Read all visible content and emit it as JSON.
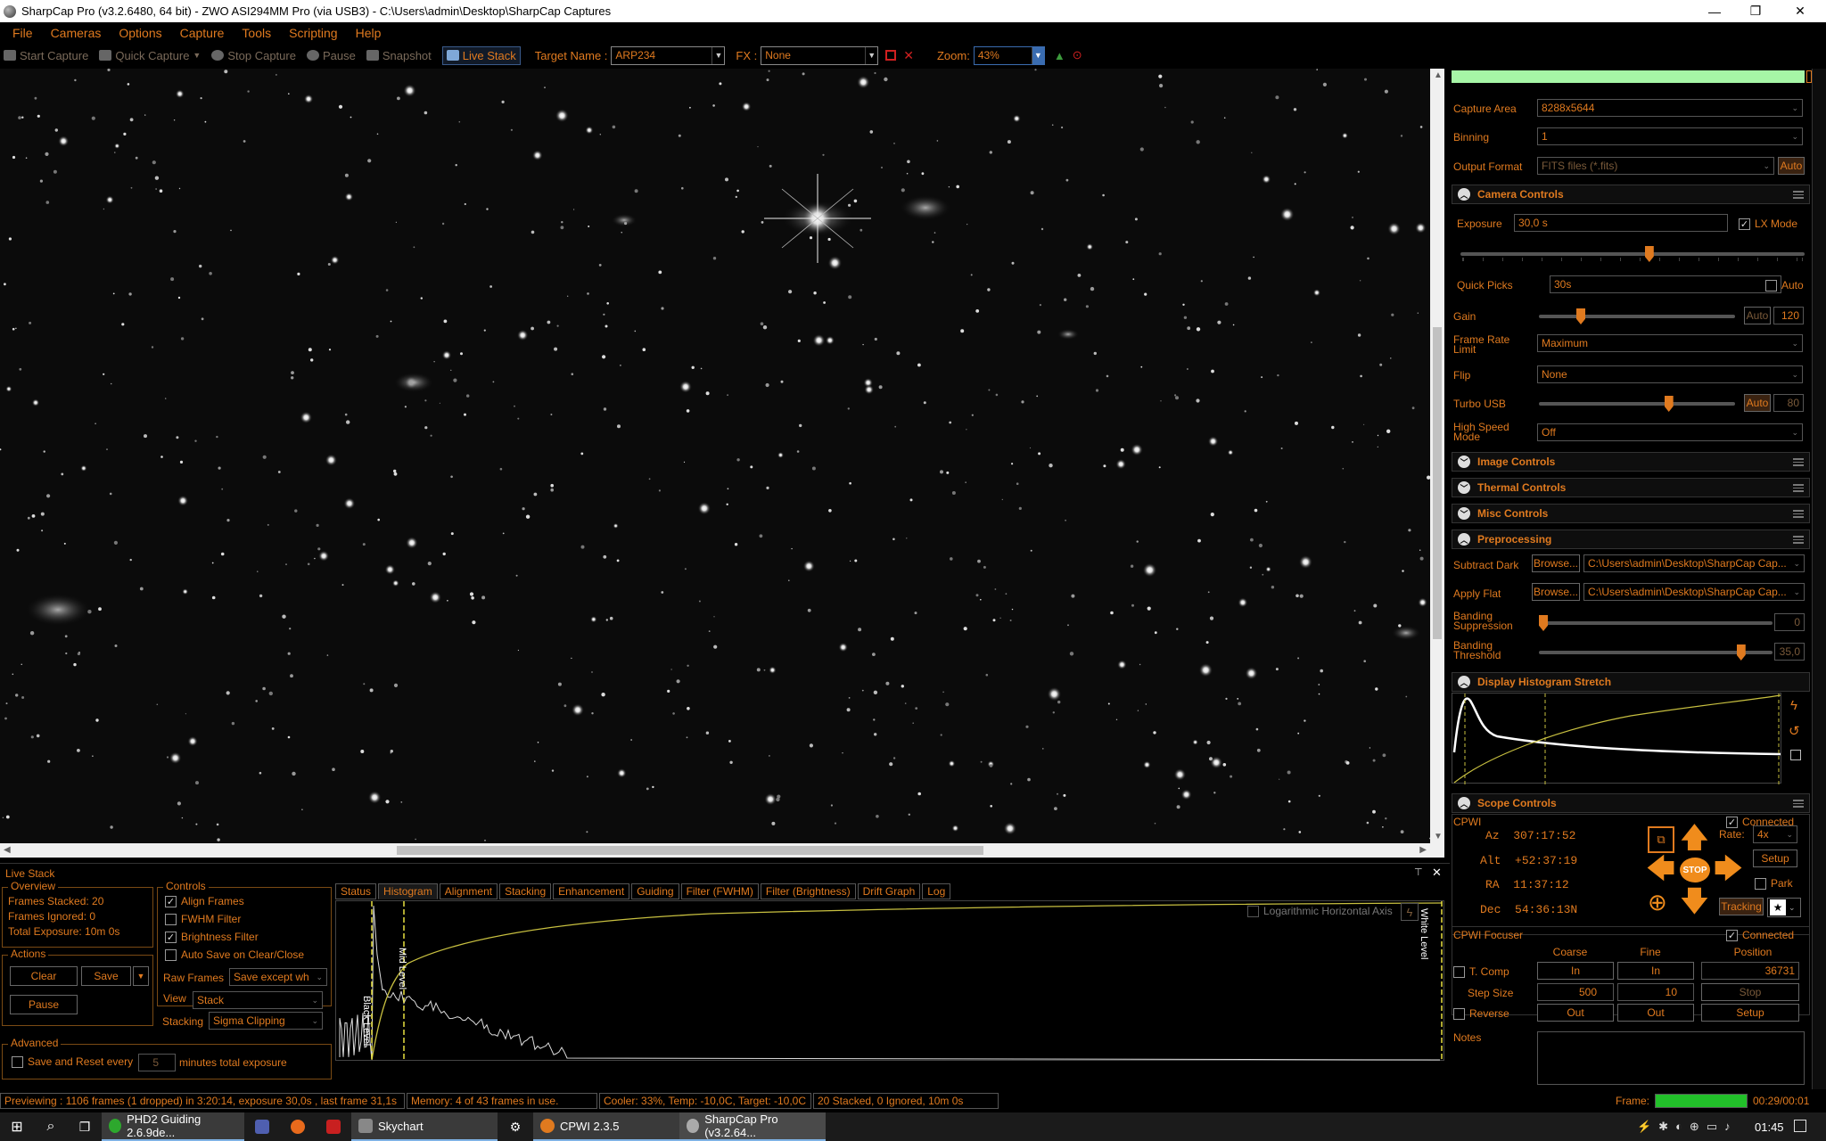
{
  "window": {
    "title": "SharpCap Pro (v3.2.6480, 64 bit) - ZWO ASI294MM Pro (via USB3) - C:\\Users\\admin\\Desktop\\SharpCap Captures",
    "minimize": "—",
    "restore": "❐",
    "close": "✕"
  },
  "menu": [
    "File",
    "Cameras",
    "Options",
    "Capture",
    "Tools",
    "Scripting",
    "Help"
  ],
  "toolbar": {
    "start_capture": "Start Capture",
    "quick_capture": "Quick Capture",
    "stop_capture": "Stop Capture",
    "pause": "Pause",
    "snapshot": "Snapshot",
    "live_stack": "Live Stack",
    "target_name_label": "Target Name :",
    "target_name_value": "ARP234",
    "fx_label": "FX :",
    "fx_value": "None",
    "zoom_label": "Zoom:",
    "zoom_value": "43%"
  },
  "right_panel": {
    "capture_area_label": "Capture Area",
    "capture_area_value": "8288x5644",
    "binning_label": "Binning",
    "binning_value": "1",
    "output_format_label": "Output Format",
    "output_format_value": "FITS files (*.fits)",
    "output_format_auto": "Auto",
    "camera_controls": "Camera Controls",
    "exposure_label": "Exposure",
    "exposure_value": "30,0 s",
    "lx_mode": "LX Mode",
    "lx_mode_checked": true,
    "exposure_slider": 0.55,
    "quick_picks_label": "Quick Picks",
    "quick_picks_value": "30s",
    "quick_picks_auto": "Auto",
    "gain_label": "Gain",
    "gain_auto": "Auto",
    "gain_value": "120",
    "gain_slider": 0.2,
    "frame_rate_label": "Frame Rate Limit",
    "frame_rate_value": "Maximum",
    "flip_label": "Flip",
    "flip_value": "None",
    "turbo_usb_label": "Turbo USB",
    "turbo_usb_auto": "Auto",
    "turbo_usb_value": "80",
    "turbo_usb_slider": 0.67,
    "high_speed_label": "High Speed Mode",
    "high_speed_value": "Off",
    "image_controls": "Image Controls",
    "thermal_controls": "Thermal Controls",
    "misc_controls": "Misc Controls",
    "preprocessing": "Preprocessing",
    "subtract_dark_label": "Subtract Dark",
    "browse": "Browse...",
    "subtract_dark_path": "C:\\Users\\admin\\Desktop\\SharpCap Cap...",
    "apply_flat_label": "Apply Flat",
    "apply_flat_path": "C:\\Users\\admin\\Desktop\\SharpCap Cap...",
    "banding_suppression_label": "Banding Suppression",
    "banding_suppression_value": "0",
    "banding_suppression_slider": 0.0,
    "banding_threshold_label": "Banding Threshold",
    "banding_threshold_value": "35,0",
    "banding_threshold_slider": 0.88,
    "display_histogram": "Display Histogram Stretch",
    "scope_controls": "Scope Controls",
    "cpwi": "CPWI",
    "connected": "Connected",
    "az_label": "Az",
    "az_value": "307:17:52",
    "alt_label": "Alt",
    "alt_value": "+52:37:19",
    "ra_label": "RA",
    "ra_value": "11:37:12",
    "dec_label": "Dec",
    "dec_value": "54:36:13N",
    "rate_label": "Rate:",
    "rate_value": "4x",
    "setup": "Setup",
    "park": "Park",
    "stop": "STOP",
    "tracking": "Tracking",
    "cpwi_focuser": "CPWI Focuser",
    "focuser_connected": "Connected",
    "coarse": "Coarse",
    "fine": "Fine",
    "position": "Position",
    "t_comp": "T. Comp",
    "in": "In",
    "position_value": "36731",
    "step_size_label": "Step Size",
    "step_coarse": "500",
    "step_fine": "10",
    "stop_btn": "Stop",
    "reverse": "Reverse",
    "out": "Out",
    "setup_btn": "Setup",
    "notes": "Notes"
  },
  "live_stack": {
    "title": "Live Stack",
    "overview": "Overview",
    "frames_stacked": "Frames Stacked: 20",
    "frames_ignored": "Frames Ignored:  0",
    "total_exposure": "Total Exposure:    10m 0s",
    "actions": "Actions",
    "clear": "Clear",
    "save": "Save",
    "pause": "Pause",
    "controls": "Controls",
    "align_frames": "Align Frames",
    "fwhm_filter": "FWHM Filter",
    "brightness_filter": "Brightness Filter",
    "auto_save": "Auto Save on Clear/Close",
    "raw_frames_label": "Raw Frames",
    "raw_frames_value": "Save except wh",
    "view_label": "View",
    "view_value": "Stack",
    "stacking_label": "Stacking",
    "stacking_value": "Sigma Clipping",
    "advanced": "Advanced",
    "save_reset_label": "Save and Reset every",
    "save_reset_value": "5",
    "save_reset_suffix": "minutes total exposure",
    "tabs": [
      "Status",
      "Histogram",
      "Alignment",
      "Stacking",
      "Enhancement",
      "Guiding",
      "Filter (FWHM)",
      "Filter (Brightness)",
      "Drift Graph",
      "Log"
    ],
    "active_tab": "Histogram",
    "log_axis": "Logarithmic Horizontal Axis",
    "black_level": "Black Level",
    "mid_level": "Mid Level",
    "white_level": "White Level"
  },
  "status": {
    "previewing": "Previewing : 1106 frames (1 dropped) in 3:20:14, exposure 30,0s , last frame 31,1s",
    "memory": "Memory: 4 of 43 frames in use.",
    "cooler": "Cooler: 33%, Temp: -10,0C, Target: -10,0C",
    "stacked": "20 Stacked, 0 Ignored, 10m 0s",
    "frame_label": "Frame:",
    "frame_time": "00:29/00:01"
  },
  "taskbar": {
    "items": [
      "PHD2 Guiding 2.6.9de...",
      "Skychart",
      "CPWI 2.3.5",
      "SharpCap Pro (v3.2.64..."
    ],
    "clock": "01:45"
  },
  "colors": {
    "accent": "#e07a1f",
    "histogram_curve": "#c8c040",
    "start_banner": "#a6f5a6"
  }
}
